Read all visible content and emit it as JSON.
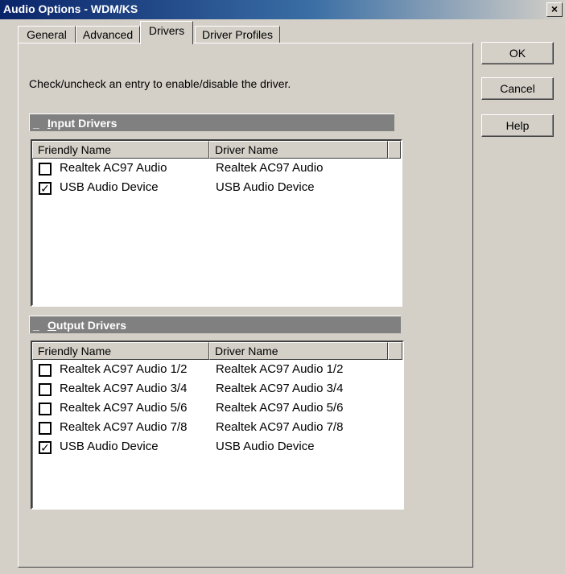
{
  "window": {
    "title": "Audio Options - WDM/KS",
    "close_glyph": "×"
  },
  "tabs": [
    {
      "label": "General"
    },
    {
      "label": "Advanced"
    },
    {
      "label": "Drivers",
      "active": true
    },
    {
      "label": "Driver Profiles"
    }
  ],
  "instruction": "Check/uncheck an entry to enable/disable the driver.",
  "input_drivers": {
    "header_prefix": "_",
    "header_mnemonic": "I",
    "header_rest": "nput Drivers",
    "columns": [
      "Friendly Name",
      "Driver Name"
    ],
    "rows": [
      {
        "checked": false,
        "friendly": "Realtek AC97 Audio",
        "driver": "Realtek AC97 Audio"
      },
      {
        "checked": true,
        "friendly": "USB Audio Device",
        "driver": "USB Audio Device"
      }
    ]
  },
  "output_drivers": {
    "header_prefix": "_",
    "header_mnemonic": "O",
    "header_rest": "utput Drivers",
    "columns": [
      "Friendly Name",
      "Driver Name"
    ],
    "rows": [
      {
        "checked": false,
        "friendly": "Realtek AC97 Audio 1/2",
        "driver": "Realtek AC97 Audio 1/2"
      },
      {
        "checked": false,
        "friendly": "Realtek AC97 Audio 3/4",
        "driver": "Realtek AC97 Audio 3/4"
      },
      {
        "checked": false,
        "friendly": "Realtek AC97 Audio 5/6",
        "driver": "Realtek AC97 Audio 5/6"
      },
      {
        "checked": false,
        "friendly": "Realtek AC97 Audio 7/8",
        "driver": "Realtek AC97 Audio 7/8"
      },
      {
        "checked": true,
        "friendly": "USB Audio Device",
        "driver": "USB Audio Device"
      }
    ]
  },
  "buttons": {
    "ok": "OK",
    "cancel": "Cancel",
    "help": "Help"
  },
  "check_glyph": "✓"
}
